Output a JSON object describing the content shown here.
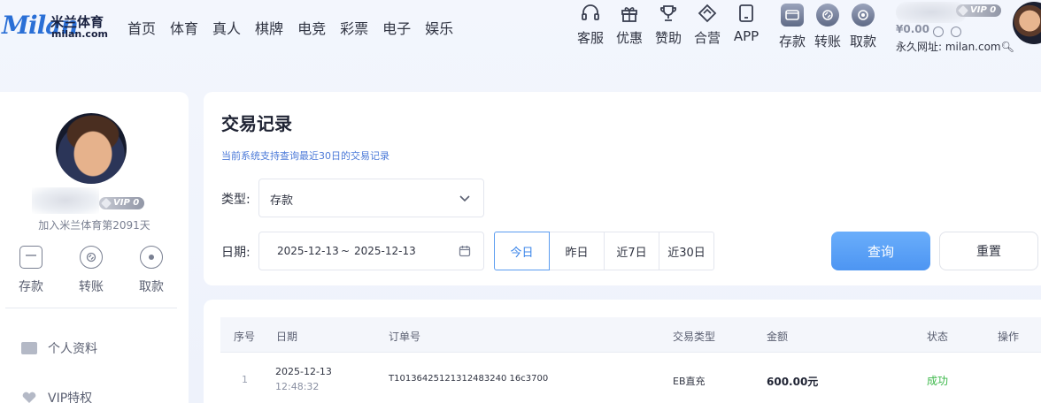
{
  "logo": {
    "script": "Milan",
    "cn": "米兰体育",
    "en": "milan.com"
  },
  "nav": [
    "首页",
    "体育",
    "真人",
    "棋牌",
    "电竞",
    "彩票",
    "电子",
    "娱乐"
  ],
  "top_icons": [
    {
      "label": "客服",
      "icon": "headset-icon"
    },
    {
      "label": "优惠",
      "icon": "gift-icon"
    },
    {
      "label": "赞助",
      "icon": "trophy-icon"
    },
    {
      "label": "合营",
      "icon": "handshake-icon"
    },
    {
      "label": "APP",
      "icon": "tablet-icon"
    },
    {
      "label": "存款",
      "icon": "wallet-icon"
    },
    {
      "label": "转账",
      "icon": "transfer-icon"
    },
    {
      "label": "取款",
      "icon": "withdraw-icon"
    }
  ],
  "user": {
    "vip": "VIP 0",
    "balance": "¥0.00",
    "url_label": "永久网址: milan.com",
    "join_text": "加入米兰体育第2091天"
  },
  "sidebar": {
    "actions": [
      {
        "label": "存款",
        "icon": "wallet-icon"
      },
      {
        "label": "转账",
        "icon": "transfer-icon"
      },
      {
        "label": "取款",
        "icon": "withdraw-icon"
      }
    ],
    "menu": [
      {
        "label": "个人资料",
        "icon": "id-card-icon"
      },
      {
        "label": "VIP特权",
        "icon": "heart-icon"
      }
    ]
  },
  "filter": {
    "title": "交易记录",
    "subtitle": "当前系统支持查询最近30日的交易记录",
    "type_label": "类型:",
    "type_value": "存款",
    "date_label": "日期:",
    "date_start": "2025-12-13",
    "date_sep": "~",
    "date_end": "2025-12-13",
    "quick": [
      "今日",
      "昨日",
      "近7日",
      "近30日"
    ],
    "quick_active": 0,
    "query_label": "查询",
    "reset_label": "重置"
  },
  "table": {
    "columns": [
      "序号",
      "日期",
      "订单号",
      "交易类型",
      "金额",
      "状态",
      "操作"
    ],
    "rows": [
      {
        "index": "1",
        "date": "2025-12-13",
        "time": "12:48:32",
        "order_no": "T10136425121312483240 16c3700",
        "type": "EB直充",
        "amount": "600.00元",
        "status": "成功"
      }
    ]
  },
  "colors": {
    "accent": "#4d95f2",
    "success": "#3cb84a",
    "subtitle": "#4c7ad8"
  }
}
